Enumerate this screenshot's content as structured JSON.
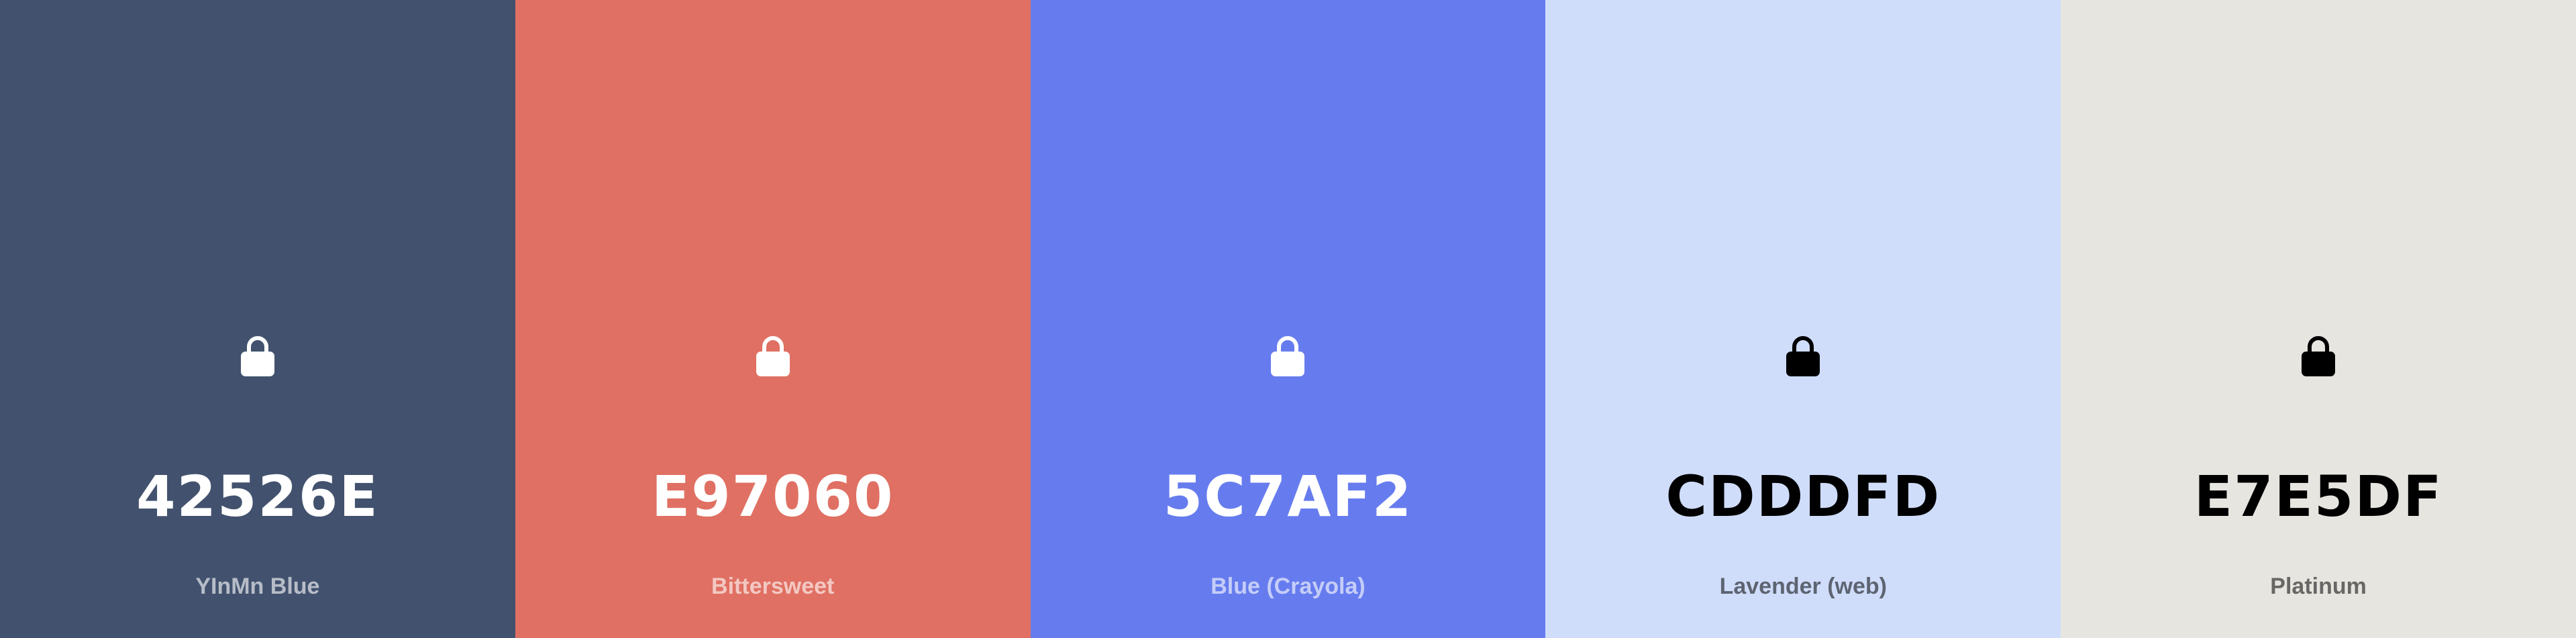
{
  "swatches": [
    {
      "hex": "42526E",
      "name": "YInMn Blue",
      "bg": "#42526E",
      "fg": "#FFFFFF",
      "name_color": "rgba(255,255,255,0.62)",
      "icon": "lock-icon"
    },
    {
      "hex": "E97060",
      "name": "Bittersweet",
      "bg": "#E07063",
      "fg": "#FFFFFF",
      "name_color": "rgba(255,255,255,0.62)",
      "icon": "lock-icon"
    },
    {
      "hex": "5C7AF2",
      "name": "Blue (Crayola)",
      "bg": "#667CEE",
      "fg": "#FFFFFF",
      "name_color": "rgba(255,255,255,0.62)",
      "icon": "lock-icon"
    },
    {
      "hex": "CDDDFD",
      "name": "Lavender (web)",
      "bg": "#CFDDFB",
      "fg": "#000000",
      "name_color": "rgba(0,0,0,0.55)",
      "icon": "lock-icon"
    },
    {
      "hex": "E7E5DF",
      "name": "Platinum",
      "bg": "#E7E5DF",
      "fg": "#000000",
      "name_color": "rgba(0,0,0,0.55)",
      "icon": "lock-icon"
    }
  ]
}
